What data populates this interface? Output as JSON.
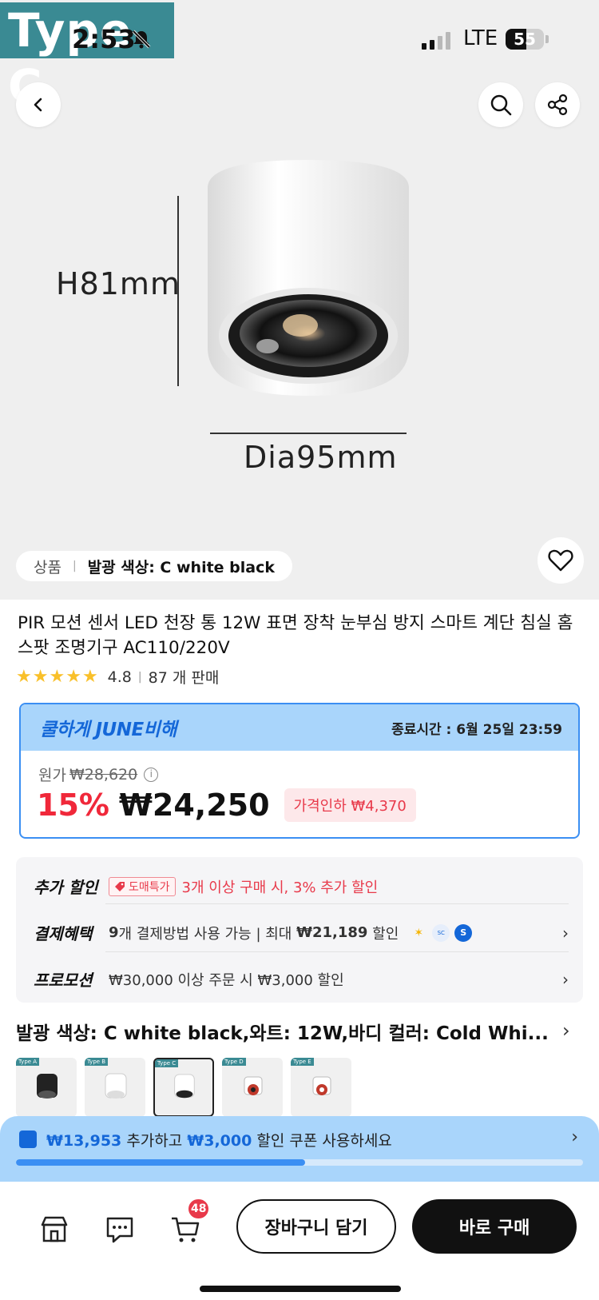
{
  "status_bar": {
    "watermark": "Type C",
    "time": "2:53",
    "network": "LTE",
    "battery": "55",
    "battery_level": 0.55
  },
  "hero": {
    "height_label": "H81mm",
    "diameter_label": "Dia95mm",
    "option_chip": {
      "label": "상품",
      "value": "발광 색상: C white black"
    }
  },
  "product": {
    "title": "PIR 모션 센서 LED 천장 통 12W 표면 장착 눈부심 방지 스마트 계단 침실 홈 스팟 조명기구 AC110/220V",
    "rating": "4.8",
    "stars": 5,
    "sold": "87 개 판매"
  },
  "promo": {
    "name": "쿨하게 JUNE비해",
    "end_time": "종료시간 : 6월 25일 23:59",
    "orig_label": "원가",
    "orig_price": "₩28,620",
    "discount": "15%",
    "sale_price": "₩24,250",
    "price_drop": "가격인하 ₩4,370"
  },
  "benefits": {
    "extra": {
      "label": "추가 할인",
      "tag": "도매특가",
      "text": "3개 이상 구매 시, 3% 추가 할인"
    },
    "payment": {
      "label": "결제혜택",
      "count": "9",
      "text_pre": "개 결제방법 사용 가능 | 최대 ",
      "amount": "₩21,189",
      "text_post": " 할인"
    },
    "promotion": {
      "label": "프로모션",
      "text": "₩30,000 이상 주문 시 ₩3,000 할인"
    }
  },
  "options": {
    "summary": "발광 색상: C white black,와트: 12W,바디 컬러: Cold Whi...",
    "thumb_badges": [
      "Type A",
      "Type B",
      "Type C",
      "Type D",
      "Type E"
    ]
  },
  "coupon": {
    "amount": "₩13,953",
    "mid": " 추가하고 ",
    "discount": "₩3,000",
    "tail": " 할인 쿠폰 사용하세요",
    "progress": 0.51
  },
  "bottom": {
    "cart_count": "48",
    "add_to_cart": "장바구니 담기",
    "buy_now": "바로 구매"
  },
  "colors": {
    "accent_blue": "#3b8ff3",
    "promo_bg": "#a9d5fb",
    "sale_red": "#f0283a",
    "star": "#f9c02a"
  }
}
